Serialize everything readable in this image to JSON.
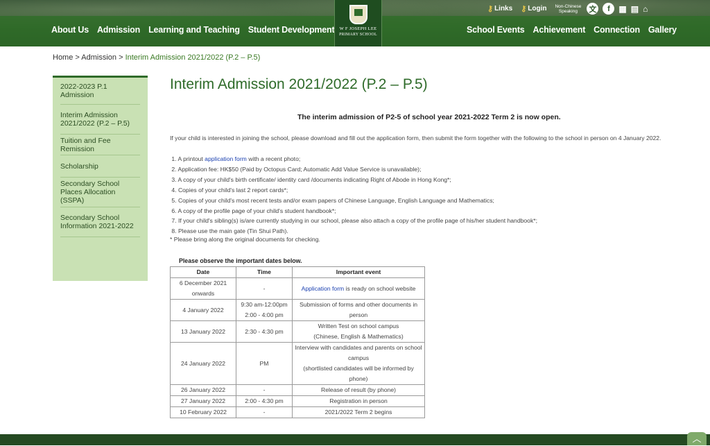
{
  "header": {
    "nav_left": [
      "About Us",
      "Admission",
      "Learning and Teaching",
      "Student Development"
    ],
    "nav_right": [
      "School Events",
      "Achievement",
      "Connection",
      "Gallery"
    ],
    "logo_line1": "W F JOSEPH LEE",
    "logo_line2": "PRIMARY SCHOOL",
    "links_label": "Links",
    "login_label": "Login",
    "ncs_line1": "Non-Chinese",
    "ncs_line2": "Speaking"
  },
  "breadcrumb": {
    "home": "Home",
    "sep1": " > ",
    "admission": "Admission",
    "sep2": " > ",
    "current": "Interim Admission 2021/2022 (P.2 – P.5)"
  },
  "sidebar": {
    "items": [
      "2022-2023 P.1 Admission",
      "Interim Admission 2021/2022 (P.2 – P.5)",
      "Tuition and Fee Remission",
      "Scholarship",
      "Secondary School Places Allocation (SSPA)",
      "Secondary School Information 2021-2022"
    ]
  },
  "content": {
    "title": "Interim Admission 2021/2022 (P.2 – P.5)",
    "subhead": "The interim admission of P2-5 of school year 2021-2022 Term 2 is now open.",
    "intro": "If your child is interested in joining the school, please download and fill out the application form, then submit the form together with the following to the school in person on 4 January 2022.",
    "item1_pre": "1. A printout ",
    "item1_link": "application form",
    "item1_post": " with a recent photo;",
    "items": [
      "2. Application fee: HK$50 (Paid by Octopus Card; Automatic Add Value Service is unavailable);",
      "3. A copy of your child's birth certificate/ identity card /documents indicating Right of Abode in Hong Kong*;",
      "4. Copies of your child's last 2 report cards*;",
      "5. Copies of your child's most recent tests and/or exam papers of Chinese Language, English Language and Mathematics;",
      "6. A copy of the profile page of your child's student handbook*;",
      "7. If your child's sibling(s) is/are currently studying in our school, please also attach a copy of the profile page of his/her student handbook*;",
      "8. Please use the main gate (Tin Shui Path)."
    ],
    "note": "* Please bring along the original documents for checking.",
    "table_caption": "Please observe the important dates below."
  },
  "table": {
    "headers": [
      "Date",
      "Time",
      "Important event"
    ],
    "r0": {
      "date": "6 December 2021 onwards",
      "time": "-",
      "event_link": "Application form",
      "event_post": " is ready on school website"
    },
    "r1": {
      "date": "4 January 2022",
      "time1": "9:30 am-12:00pm",
      "time2": "2:00 - 4:00 pm",
      "event": "Submission of forms and other documents in person"
    },
    "r2": {
      "date": "13 January 2022",
      "time": "2:30 - 4:30 pm",
      "event1": "Written Test on school campus",
      "event2": "(Chinese, English & Mathematics)"
    },
    "r3": {
      "date": "24 January 2022",
      "time": "PM",
      "event1": "Interview with candidates and parents on school campus",
      "event2": "(shortlisted candidates will be informed by phone)"
    },
    "r4": {
      "date": "26 January 2022",
      "time": "-",
      "event": "Release of result (by phone)"
    },
    "r5": {
      "date": "27 January 2022",
      "time": "2:00 - 4:30 pm",
      "event": "Registration in person"
    },
    "r6": {
      "date": "10 February 2022",
      "time": "-",
      "event": "2021/2022 Term 2 begins"
    }
  },
  "icons": [
    "key-icon",
    "chinese-language-icon",
    "facebook-icon",
    "calendar-icon",
    "book-icon",
    "home-icon",
    "back-to-top-icon"
  ],
  "colors": {
    "brand_green": "#2f6b2a",
    "sidebar_bg": "#c9e1b4",
    "link_blue": "#1a3fb0"
  }
}
